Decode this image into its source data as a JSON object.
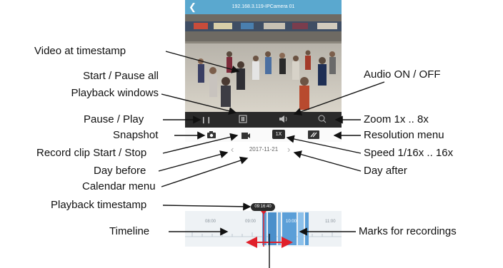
{
  "screen": {
    "title": "192.168.3.119-IPCamera 01",
    "date": "2017-11-21",
    "speed": "1X",
    "timestamp": "09:16:40",
    "hours": [
      "08:00",
      "09:00",
      "10:00",
      "11:00"
    ]
  },
  "annotations": {
    "video_at_timestamp": "Video at timestamp",
    "start_pause_all_1": "Start / Pause all",
    "start_pause_all_2": "Playback windows",
    "pause_play": "Pause / Play",
    "snapshot": "Snapshot",
    "record_clip": "Record clip Start / Stop",
    "day_before": "Day before",
    "calendar_menu": "Calendar menu",
    "playback_timestamp": "Playback timestamp",
    "timeline": "Timeline",
    "audio": "Audio ON / OFF",
    "zoom": "Zoom 1x .. 8x",
    "resolution_menu": "Resolution menu",
    "speed": "Speed 1/16x .. 16x",
    "day_after": "Day after",
    "marks": "Marks for recordings"
  },
  "colors": {
    "header": "#5aa8cf",
    "control_bar": "#2a2a2a",
    "recording_mark": "#5b9fd8",
    "playhead": "#e0202a",
    "drag_arrow": "#e0202a"
  }
}
